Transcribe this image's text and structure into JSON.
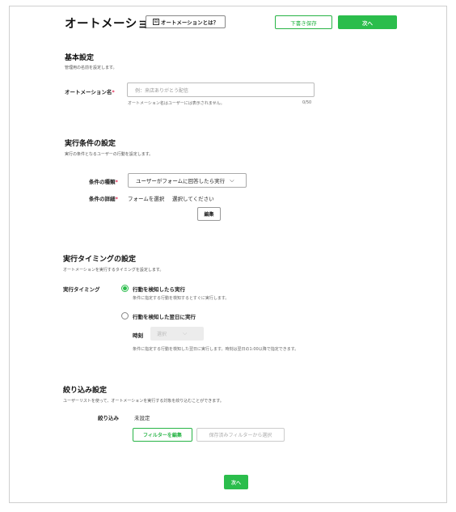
{
  "header": {
    "title": "オートメーション",
    "help_label": "オートメーションとは？",
    "draft_label": "下書き保存",
    "next_label": "次へ"
  },
  "basic": {
    "title": "基本設定",
    "description": "管理用の名前を設定します。",
    "name_label": "オートメーション名",
    "required_mark": "*",
    "name_placeholder": "例：来店ありがとう配信",
    "name_hint": "オートメーション名はユーザーには表示されません。",
    "char_count": "0/50"
  },
  "condition": {
    "title": "実行条件の設定",
    "description": "実行の条件となるユーザーの行動を設定します。",
    "type_label": "条件の種類",
    "type_value": "ユーザーがフォームに回答したら実行",
    "detail_label": "条件の詳細",
    "detail_form": "フォームを選択",
    "detail_value": "選択してください",
    "edit_label": "編集"
  },
  "timing": {
    "title": "実行タイミングの設定",
    "description": "オートメーションを実行するタイミングを設定します。",
    "label": "実行タイミング",
    "option1_title": "行動を検知したら実行",
    "option1_desc": "条件に指定する行動を検知するとすぐに実行します。",
    "option2_title": "行動を検知した翌日に実行",
    "time_label": "時刻",
    "time_placeholder": "選択",
    "option2_desc": "条件に指定する行動を検知した翌日に実行します。時刻は翌日の1:00以降で指定できます。",
    "selected_option": 1
  },
  "filter": {
    "title": "絞り込み設定",
    "description": "ユーザーリストを使って、オートメーションを実行する対象を絞り込むことができます。",
    "label": "絞り込み",
    "value": "未設定",
    "edit_label": "フィルターを編集",
    "saved_label": "保存済みフィルターから選択"
  },
  "footer": {
    "next_label": "次へ"
  },
  "colors": {
    "accent": "#2bbd4c",
    "required": "#e0254f"
  }
}
